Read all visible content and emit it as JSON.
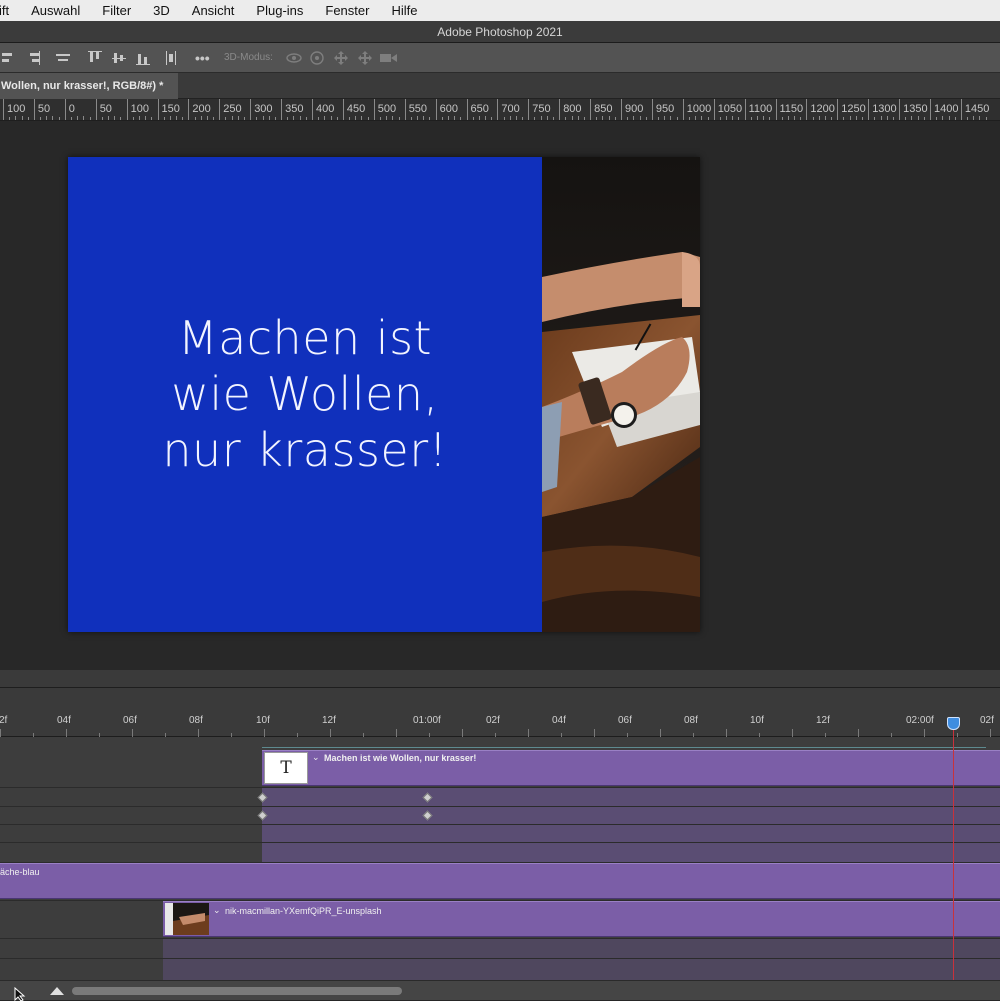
{
  "menubar": {
    "items": [
      "ift",
      "Auswahl",
      "Filter",
      "3D",
      "Ansicht",
      "Plug-ins",
      "Fenster",
      "Hilfe"
    ]
  },
  "window": {
    "title": "Adobe Photoshop 2021"
  },
  "options_bar": {
    "mode_label": "3D-Modus:"
  },
  "document_tab": {
    "label": "Wollen, nur krasser!, RGB/8#) *"
  },
  "ruler": {
    "labels": [
      "100",
      "50",
      "0",
      "50",
      "100",
      "150",
      "200",
      "250",
      "300",
      "350",
      "400",
      "450",
      "500",
      "550",
      "600",
      "650",
      "700",
      "750",
      "800",
      "850",
      "900",
      "950",
      "1000",
      "1050",
      "1100",
      "1150",
      "1200",
      "1250",
      "1300",
      "1350",
      "1400",
      "1450"
    ]
  },
  "canvas": {
    "headline_line1": "Machen ist",
    "headline_line2": "wie Wollen,",
    "headline_line3": "nur krasser!",
    "background_color": "#1030bc"
  },
  "timeline": {
    "ruler_labels": [
      "2f",
      "04f",
      "06f",
      "08f",
      "10f",
      "12f",
      "01:00f",
      "02f",
      "04f",
      "06f",
      "08f",
      "10f",
      "12f",
      "02:00f",
      "02f"
    ],
    "text_layer": {
      "icon": "T",
      "label": "Machen ist wie Wollen, nur krasser!"
    },
    "fill_layer": {
      "label": "äche-blau"
    },
    "image_layer": {
      "label": "nik-macmillan-YXemfQiPR_E-unsplash"
    },
    "playhead_color": "#c8323c",
    "clip_color": "#7b5ea7"
  }
}
